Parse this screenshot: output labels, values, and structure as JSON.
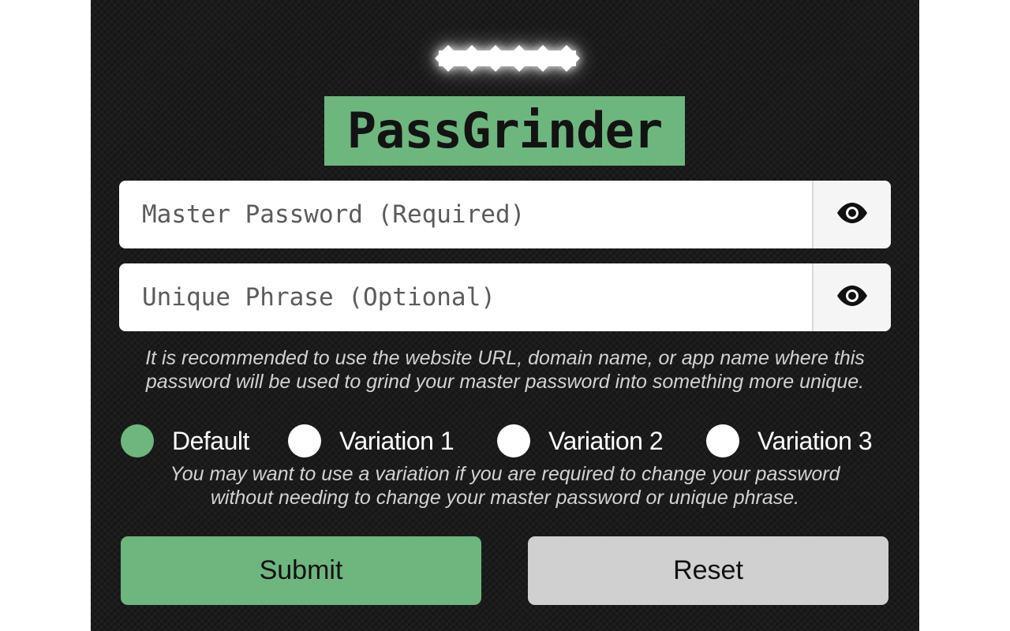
{
  "app": {
    "name": "PassGrinder"
  },
  "master_password": {
    "placeholder": "Master Password (Required)",
    "value": "",
    "toggle_icon": "eye-icon"
  },
  "unique_phrase": {
    "placeholder": "Unique Phrase (Optional)",
    "value": "",
    "toggle_icon": "eye-icon"
  },
  "phrase_hint": {
    "line1": "It is recommended to use the website URL, domain name, or app name where this",
    "line2": "password will be used to grind your master password into something more unique."
  },
  "variations": {
    "selected": "Default",
    "options": [
      {
        "label": "Default",
        "checked": true
      },
      {
        "label": "Variation 1",
        "checked": false
      },
      {
        "label": "Variation 2",
        "checked": false
      },
      {
        "label": "Variation 3",
        "checked": false
      }
    ]
  },
  "variation_hint": {
    "line1": "You may want to use a variation if you are required to change your password",
    "line2": "without needing to change your master password or unique phrase."
  },
  "actions": {
    "submit_label": "Submit",
    "reset_label": "Reset"
  },
  "colors": {
    "accent_green": "#6db77f",
    "background": "#1b1b1b",
    "reset_gray": "#d0d0d0"
  }
}
